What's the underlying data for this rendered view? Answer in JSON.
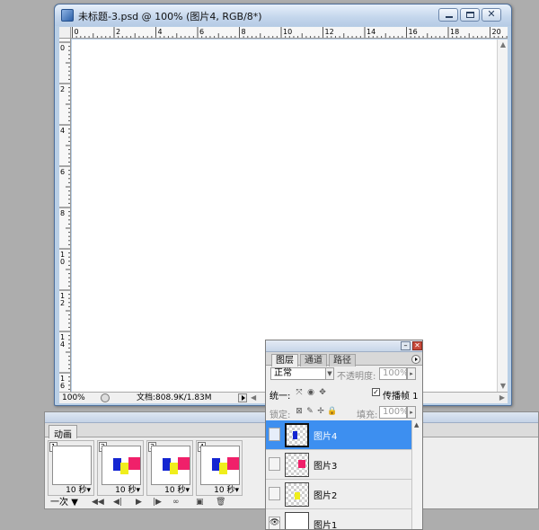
{
  "document": {
    "title": "未标题-3.psd @ 100% (图片4, RGB/8*)",
    "h_ruler_ticks": [
      "0",
      "2",
      "4",
      "6",
      "8",
      "1\n0",
      "1\n2",
      "1\n4",
      "1\n6",
      "1\n8",
      "2\n0",
      "2"
    ],
    "v_ruler_ticks": [
      "0",
      "2",
      "4",
      "6",
      "8",
      "1\n0",
      "1\n2",
      "1\n4",
      "1\n6"
    ],
    "zoom": "100%",
    "doc_info": "文档:808.9K/1.83M"
  },
  "animation": {
    "tab_label": "动画",
    "frames": [
      {
        "number": "1",
        "delay": "10 秒",
        "selected": true
      },
      {
        "number": "2",
        "delay": "10 秒",
        "selected": false
      },
      {
        "number": "3",
        "delay": "10 秒",
        "selected": false
      },
      {
        "number": "4",
        "delay": "10 秒",
        "selected": false
      }
    ],
    "loop_option": "一次"
  },
  "layers": {
    "tabs": [
      "图层",
      "通道",
      "路径"
    ],
    "blend_mode": "正常",
    "opacity_label": "不透明度:",
    "opacity_value": "100%",
    "unify_label": "统一:",
    "propagate_label": "传播帧 1",
    "lock_label": "锁定:",
    "fill_label": "填充:",
    "fill_value": "100%",
    "items": [
      {
        "name": "图片4",
        "selected": true,
        "visible": false
      },
      {
        "name": "图片3",
        "selected": false,
        "visible": false
      },
      {
        "name": "图片2",
        "selected": false,
        "visible": false
      },
      {
        "name": "图片1",
        "selected": false,
        "visible": true
      }
    ]
  },
  "colors": {
    "blue": "#1526d1",
    "yellow": "#f0ee1c",
    "red": "#f0206a",
    "selection": "#3d8ff0"
  }
}
